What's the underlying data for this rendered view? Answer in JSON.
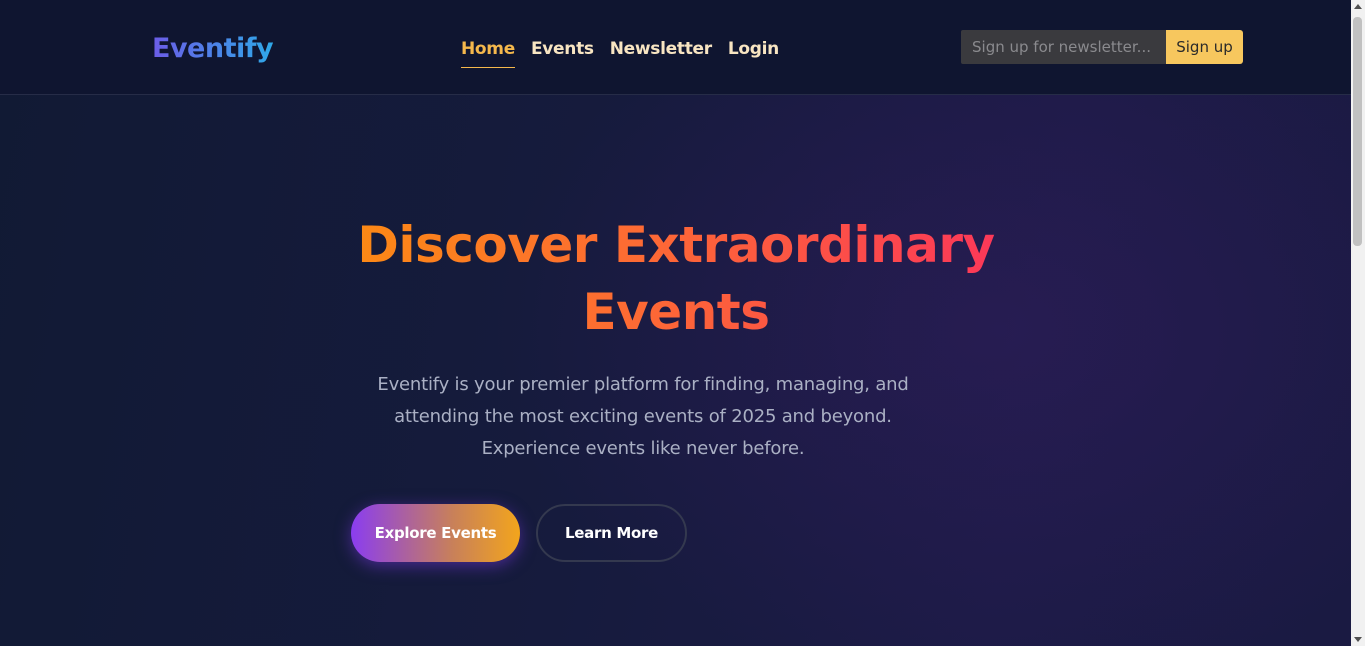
{
  "header": {
    "logo": "Eventify",
    "nav": [
      "Home",
      "Events",
      "Newsletter",
      "Login"
    ],
    "active_nav": "Home",
    "newsletter": {
      "placeholder": "Sign up for newsletter...",
      "button_label": "Sign up"
    }
  },
  "hero": {
    "title_line1": "Discover Extraordinary",
    "title_line2": "Events",
    "description_line1": "Eventify is your premier platform for finding, managing, and",
    "description_line2": "attending the most exciting events of 2025 and beyond.",
    "description_line3": "Experience events like never before.",
    "primary_button": "Explore Events",
    "secondary_button": "Learn More"
  },
  "colors": {
    "background": "#111733",
    "accent_gold": "#f5b84c",
    "title_gradient_start": "#fb8f0f",
    "title_gradient_end": "#fb2f5f",
    "button_gradient_start": "#8a3df0",
    "button_gradient_end": "#f3a51c"
  }
}
